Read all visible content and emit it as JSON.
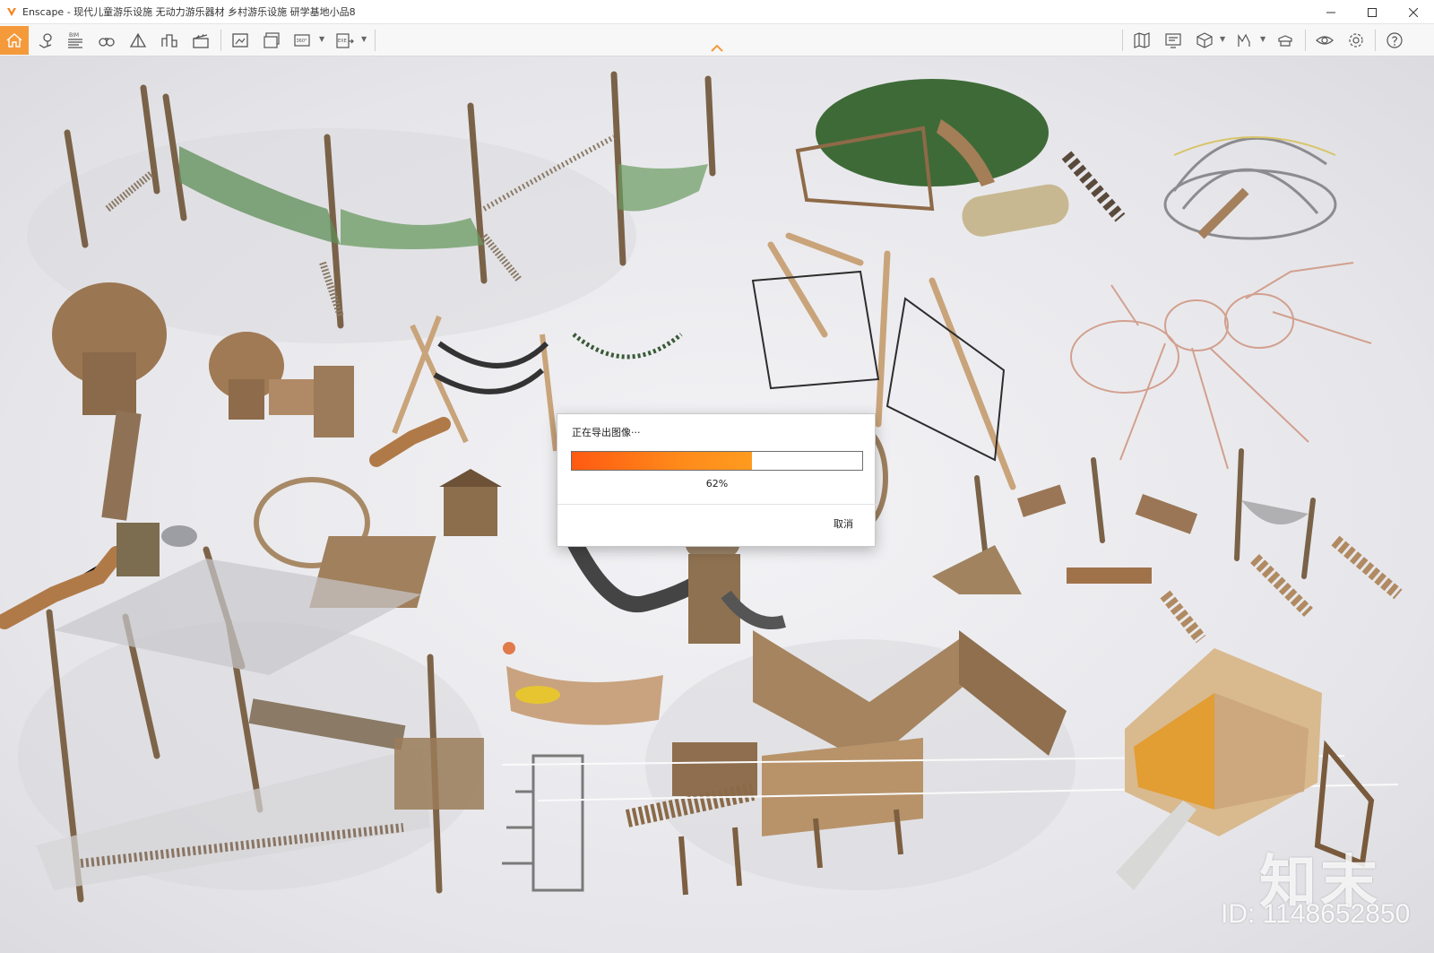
{
  "window": {
    "app_name": "Enscape",
    "title": "Enscape - 现代儿童游乐设施 无动力游乐器材 乡村游乐设施 研学基地小品8",
    "controls": [
      "minimize",
      "maximize",
      "close"
    ]
  },
  "toolbar": {
    "left_icons": [
      "home-icon",
      "location-pin-icon",
      "bim-icon",
      "binoculars-icon",
      "tent-icon",
      "buildings-icon",
      "clapper-icon"
    ],
    "bim_label": "BIM",
    "export_icons": [
      "render-image-icon",
      "batch-render-icon",
      "panorama-360-icon",
      "export-exe-icon"
    ],
    "panorama_label": "360°",
    "exe_label": "EXE",
    "right_icons": [
      "map-icon",
      "monitor-icon",
      "cube-icon",
      "chart-icon",
      "hat-icon",
      "eye-icon",
      "gear-icon",
      "help-icon"
    ],
    "accent_color": "#f59a3b"
  },
  "dialog": {
    "title": "正在导出图像···",
    "progress_value": 0.62,
    "progress_text": "62%",
    "cancel_label": "取消",
    "fill_color": "#ff6a14"
  },
  "watermark": {
    "logo_text": "知末",
    "id_text": "ID: 1148652850"
  }
}
